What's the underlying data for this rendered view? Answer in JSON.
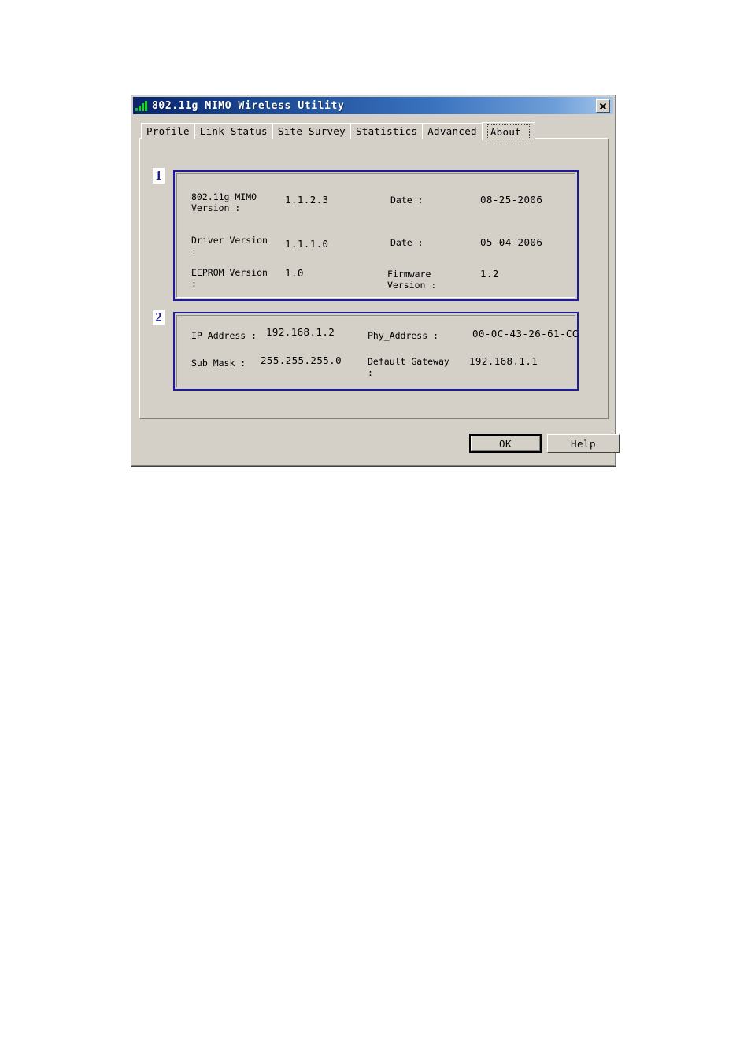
{
  "window": {
    "title": "802.11g MIMO Wireless Utility",
    "icon": "signal-bars-icon",
    "close_label": "X",
    "titlebar_color": "#0a246a",
    "face_color": "#d4d0c8"
  },
  "tabs": [
    {
      "label": "Profile",
      "active": false
    },
    {
      "label": "Link Status",
      "active": false
    },
    {
      "label": "Site Survey",
      "active": false
    },
    {
      "label": "Statistics",
      "active": false
    },
    {
      "label": "Advanced",
      "active": false
    },
    {
      "label": "About",
      "active": true
    }
  ],
  "callouts": [
    {
      "number": "1",
      "target": "version-panel"
    },
    {
      "number": "2",
      "target": "network-panel"
    }
  ],
  "version_panel": {
    "highlight_color": "#1b1b9b",
    "rows": [
      {
        "left_label": "802.11g MIMO\nVersion :",
        "left_value": "1.1.2.3",
        "right_label": "Date :",
        "right_value": "08-25-2006"
      },
      {
        "left_label": "Driver Version\n:",
        "left_value": "1.1.1.0",
        "right_label": "Date :",
        "right_value": "05-04-2006"
      },
      {
        "left_label": "EEPROM Version\n:",
        "left_value": "1.0",
        "right_label": "Firmware\nVersion :",
        "right_value": "1.2"
      }
    ]
  },
  "network_panel": {
    "highlight_color": "#1b1b9b",
    "rows": [
      {
        "left_label": "IP Address :",
        "left_value": "192.168.1.2",
        "right_label": "Phy_Address :",
        "right_value": "00-0C-43-26-61-CC"
      },
      {
        "left_label": "Sub Mask :",
        "left_value": "255.255.255.0",
        "right_label": "Default Gateway\n:",
        "right_value": "192.168.1.1"
      }
    ]
  },
  "buttons": {
    "ok": "OK",
    "help": "Help"
  }
}
